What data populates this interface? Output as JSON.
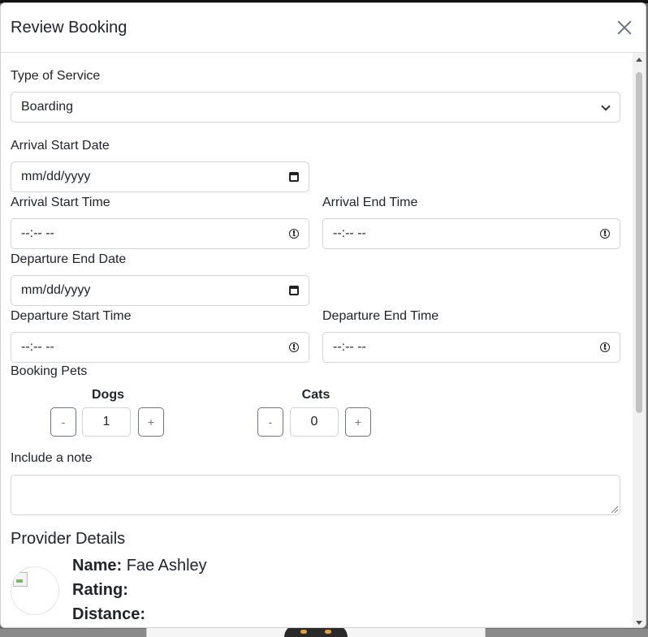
{
  "modal": {
    "title": "Review Booking",
    "close_icon": "close-icon"
  },
  "form": {
    "service": {
      "label": "Type of Service",
      "value": "Boarding"
    },
    "arrival_start_date": {
      "label": "Arrival Start Date",
      "value": "mm/dd/yyyy"
    },
    "arrival_start_time": {
      "label": "Arrival Start Time",
      "value": "--:-- --"
    },
    "arrival_end_time": {
      "label": "Arrival End Time",
      "value": "--:-- --"
    },
    "departure_end_date": {
      "label": "Departure End Date",
      "value": "mm/dd/yyyy"
    },
    "departure_start_time": {
      "label": "Departure Start Time",
      "value": "--:-- --"
    },
    "departure_end_time": {
      "label": "Departure End Time",
      "value": "--:-- --"
    },
    "booking_pets": {
      "label": "Booking Pets",
      "dogs": {
        "label": "Dogs",
        "count": "1",
        "minus": "-",
        "plus": "+"
      },
      "cats": {
        "label": "Cats",
        "count": "0",
        "minus": "-",
        "plus": "+"
      }
    },
    "note": {
      "label": "Include a note",
      "value": ""
    }
  },
  "provider": {
    "section_title": "Provider Details",
    "name_label": "Name:",
    "name_value": "Fae Ashley",
    "rating_label": "Rating:",
    "distance_label": "Distance:"
  }
}
